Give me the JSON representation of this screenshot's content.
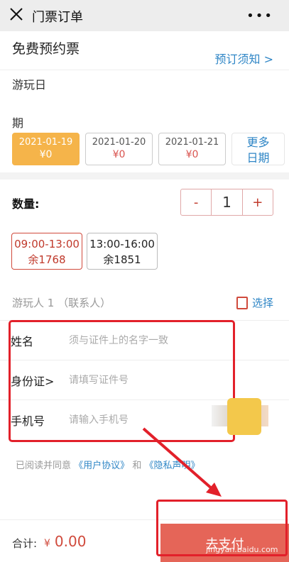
{
  "topbar": {
    "title": "门票订单",
    "more": "•••",
    "close_icon": "close-icon"
  },
  "ticket": {
    "name": "免费预约票",
    "notice_link": "预订须知 >"
  },
  "play_date": {
    "label_line1": "游玩日",
    "label_line2": "期",
    "dates": [
      {
        "date": "2021-01-19",
        "price": "¥0",
        "selected": true
      },
      {
        "date": "2021-01-20",
        "price": "¥0",
        "selected": false
      },
      {
        "date": "2021-01-21",
        "price": "¥0",
        "selected": false
      }
    ],
    "more_line1": "更多",
    "more_line2": "日期"
  },
  "quantity": {
    "label": "数量:",
    "minus": "-",
    "value": "1",
    "plus": "+"
  },
  "time_slots": [
    {
      "time": "09:00-13:00",
      "remain": "余1768",
      "selected": true
    },
    {
      "time": "13:00-16:00",
      "remain": "余1851",
      "selected": false
    }
  ],
  "visitor": {
    "header": "游玩人 1 （联系人）",
    "select_label": "选择"
  },
  "fields": [
    {
      "label": "姓名",
      "placeholder": "须与证件上的名字一致"
    },
    {
      "label": "身份证>",
      "placeholder": "请填写证件号"
    },
    {
      "label": "手机号",
      "placeholder": "请输入手机号"
    }
  ],
  "agreement": {
    "prefix": "已阅读并同意",
    "user_agreement": "《用户协议》",
    "and": "和",
    "privacy": "《隐私声明》"
  },
  "bottom": {
    "total_label": "合计:",
    "currency": "¥",
    "total_value": "0.00",
    "submit_label": "去支付"
  },
  "watermark": "jingyan.baidu.com",
  "colors": {
    "accent_blue": "#2f86c6",
    "price_red": "#d04a3c",
    "selected_date": "#f5b44a",
    "annotation_red": "#e2202a"
  }
}
